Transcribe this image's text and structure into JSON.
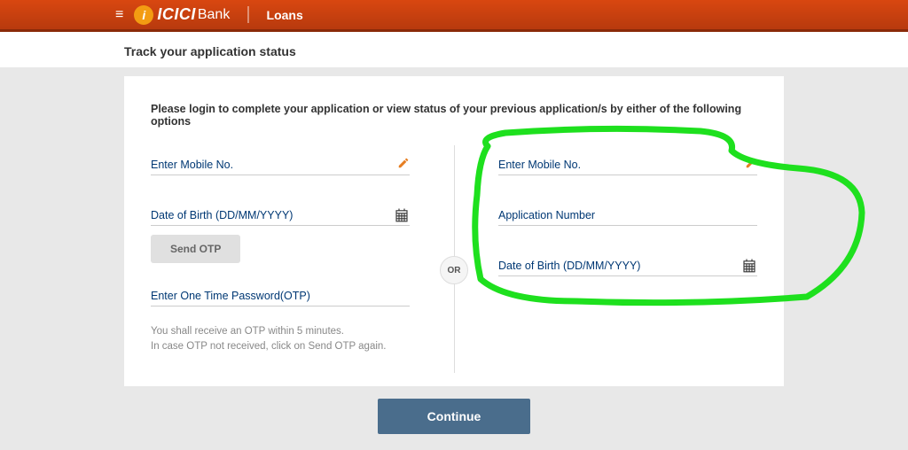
{
  "header": {
    "logo_prefix": "i",
    "logo_text": "ICICI",
    "logo_suffix": "Bank",
    "section": "Loans"
  },
  "page": {
    "title": "Track your application status",
    "instruction": "Please login to complete your application or view status of your previous application/s by either of the following options"
  },
  "left_form": {
    "mobile_label": "Enter Mobile No.",
    "dob_label": "Date of Birth (DD/MM/YYYY)",
    "send_otp_label": "Send OTP",
    "otp_label": "Enter One Time Password(OTP)",
    "help_line1": "You shall receive an OTP within 5 minutes.",
    "help_line2": "In case OTP not received, click on Send OTP again."
  },
  "divider": {
    "or_label": "OR"
  },
  "right_form": {
    "mobile_label": "Enter Mobile No.",
    "app_number_label": "Application Number",
    "dob_label": "Date of Birth (DD/MM/YYYY)"
  },
  "actions": {
    "continue_label": "Continue"
  }
}
